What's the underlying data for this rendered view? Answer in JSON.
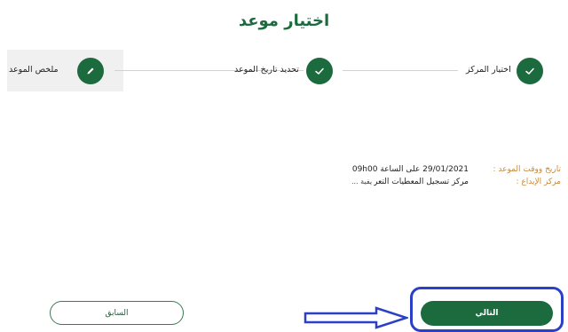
{
  "page": {
    "title": "اختيار موعد"
  },
  "steps": [
    {
      "label": "اختيار المركز",
      "icon": "check-icon",
      "state": "done"
    },
    {
      "label": "تحديد تاريخ الموعد",
      "icon": "check-icon",
      "state": "done"
    },
    {
      "label": "ملخص الموعد",
      "icon": "pencil-icon",
      "state": "active"
    }
  ],
  "summary": {
    "datetime_label": "تاريخ ووقت الموعد :",
    "datetime_value": "29/01/2021 على الساعة 09h00",
    "center_label": "مركز الإيداع :",
    "center_value": "مركز تسجيل المعطيات التعر",
    "center_value_tail": "يفية ..."
  },
  "buttons": {
    "previous": "السابق",
    "next": "التالي"
  },
  "colors": {
    "primary": "#1c6b3f",
    "label": "#c68a3f",
    "highlight": "#2b3fc7"
  }
}
